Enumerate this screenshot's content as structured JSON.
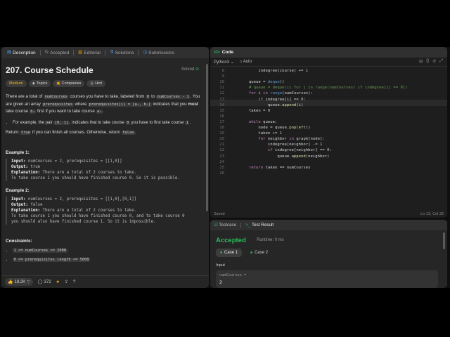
{
  "left_tabs": [
    {
      "label": "Description",
      "icon": "doc-icon"
    },
    {
      "label": "Accepted",
      "icon": "history-icon"
    },
    {
      "label": "Editorial",
      "icon": "book-icon"
    },
    {
      "label": "Solutions",
      "icon": "flask-icon"
    },
    {
      "label": "Submissions",
      "icon": "clock-icon"
    }
  ],
  "problem": {
    "title": "207. Course Schedule",
    "status": "Solved",
    "tags": [
      "Medium",
      "Topics",
      "Companies",
      "Hint"
    ],
    "desc_1a": "There are a total of ",
    "desc_code_num": "numCourses",
    "desc_1b": " courses you have to take, labeled from ",
    "desc_code_0": "0",
    "desc_1c": " to ",
    "desc_code_nm1": "numCourses - 1",
    "desc_1d": ". You are given an array ",
    "desc_code_pre": "prerequisites",
    "desc_1e": " where ",
    "desc_code_prei": "prerequisites[i] = [aᵢ, bᵢ]",
    "desc_1f": " indicates that you ",
    "desc_must": "must",
    "desc_1g": " take course ",
    "desc_code_bi": "bᵢ",
    "desc_1h": " first if you want to take course ",
    "desc_code_ai": "aᵢ",
    "desc_1i": ".",
    "bullet_a": "For example, the pair ",
    "bullet_code_01": "[0, 1]",
    "bullet_b": ", indicates that to take course ",
    "bullet_code_0": "0",
    "bullet_c": " you have to first take course ",
    "bullet_code_1": "1",
    "bullet_d": ".",
    "ret_a": "Return ",
    "ret_true": "true",
    "ret_b": " if you can finish all courses. Otherwise, return ",
    "ret_false": "false",
    "ret_c": "."
  },
  "examples": [
    {
      "heading": "Example 1:",
      "input_label": "Input:",
      "input": " numCourses = 2, prerequisites = [[1,0]]",
      "output_label": "Output:",
      "output": " true",
      "expl_label": "Explanation:",
      "expl_1": " There are a total of 2 courses to take.",
      "expl_2": "To take course 1 you should have finished course 0. So it is possible.",
      "expl_3": ""
    },
    {
      "heading": "Example 2:",
      "input_label": "Input:",
      "input": " numCourses = 2, prerequisites = [[1,0],[0,1]]",
      "output_label": "Output:",
      "output": " false",
      "expl_label": "Explanation:",
      "expl_1": " There are a total of 2 courses to take.",
      "expl_2": "To take course 1 you should have finished course 0, and to take course 0",
      "expl_3": "you should also have finished course 1. So it is impossible."
    }
  ],
  "constraints": {
    "heading": "Constraints:",
    "items": [
      "1 <= numCourses <= 2000",
      "0 <= prerequisites.length <= 5000"
    ]
  },
  "footer": {
    "likes": "18.2K",
    "comments": "372"
  },
  "code": {
    "tab": "Code",
    "language": "Python3",
    "mode": "Auto",
    "status": "Saved",
    "position": "Ln 13, Col 32",
    "lines": [
      {
        "n": "8",
        "t": "            indegree[course] += 1"
      },
      {
        "n": "9",
        "t": ""
      },
      {
        "n": "10",
        "t": "        queue = deque()"
      },
      {
        "n": "11",
        "t": "        # queue = deque([i for i in range(numCourses) if indegree[i] == 0])"
      },
      {
        "n": "12",
        "t": "        for i in range(numCourses):"
      },
      {
        "n": "13",
        "t": "            if indegree[i] == 0:"
      },
      {
        "n": "14",
        "t": "                queue.append(i)"
      },
      {
        "n": "15",
        "t": "        taken = 0"
      },
      {
        "n": "16",
        "t": ""
      },
      {
        "n": "17",
        "t": "        while queue:"
      },
      {
        "n": "18",
        "t": "            node = queue.popleft()"
      },
      {
        "n": "19",
        "t": "            taken += 1"
      },
      {
        "n": "20",
        "t": "            for neighbor in graph[node]:"
      },
      {
        "n": "21",
        "t": "                indegree[neighbor] -= 1"
      },
      {
        "n": "22",
        "t": "                if indegree[neighbor] == 0:"
      },
      {
        "n": "23",
        "t": "                    queue.append(neighbor)"
      },
      {
        "n": "24",
        "t": ""
      },
      {
        "n": "25",
        "t": "        return taken == numCourses"
      },
      {
        "n": "26",
        "t": ""
      }
    ]
  },
  "result": {
    "tab_testcase": "Testcase",
    "tab_result": "Test Result",
    "verdict": "Accepted",
    "runtime": "Runtime: 0 ms",
    "cases": [
      "Case 1",
      "Case 2"
    ],
    "input_label": "Input",
    "var_name": "numCourses =",
    "var_value": "2"
  },
  "colors": {
    "accent_green": "#2cbb5d",
    "medium": "#ffb700",
    "panel": "#262626"
  }
}
